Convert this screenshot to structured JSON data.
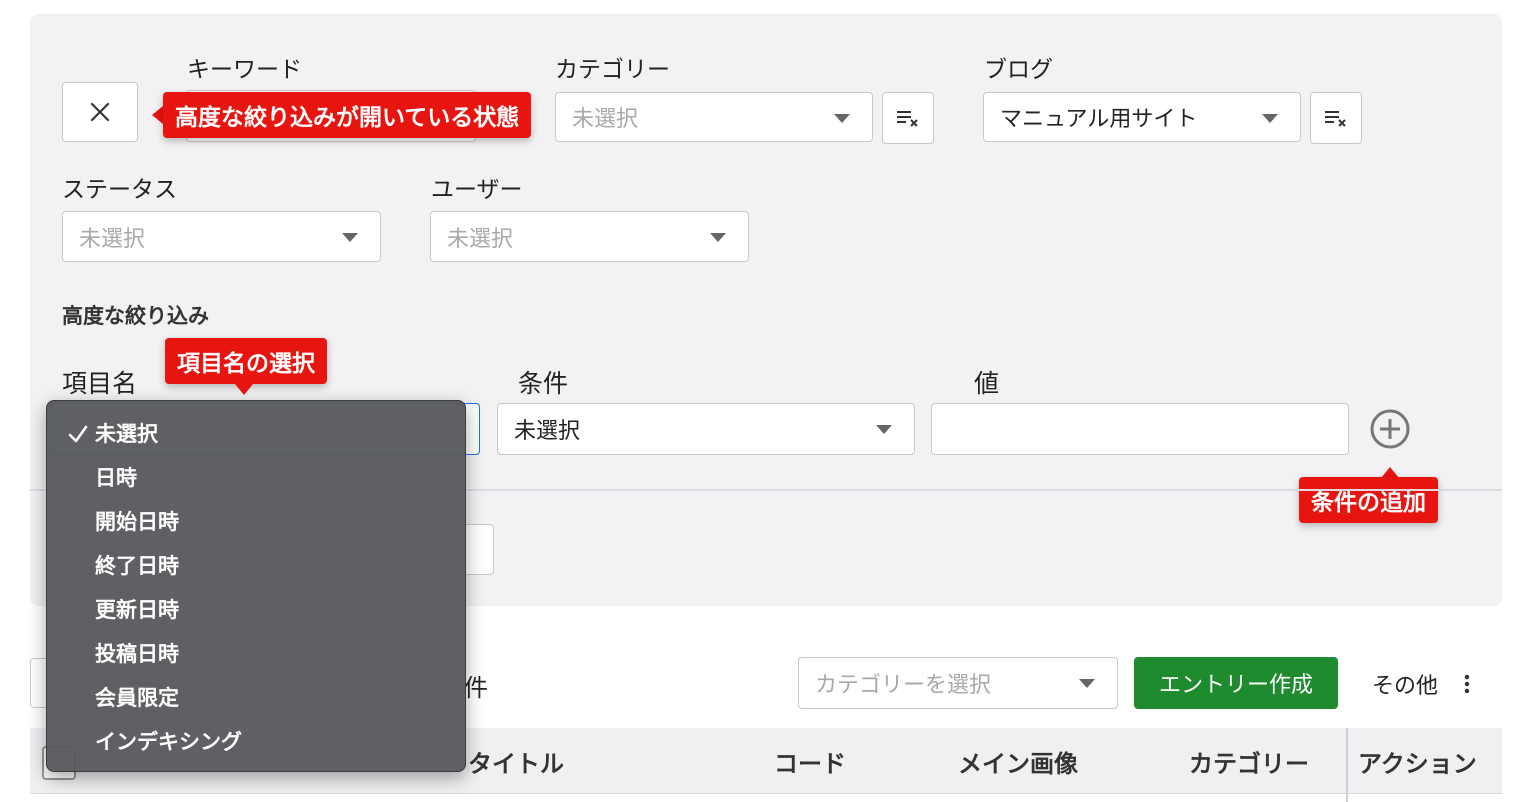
{
  "filter": {
    "keyword_label": "キーワード",
    "category_label": "カテゴリー",
    "category_value": "未選択",
    "blog_label": "ブログ",
    "blog_value": "マニュアル用サイト",
    "status_label": "ステータス",
    "status_value": "未選択",
    "user_label": "ユーザー",
    "user_value": "未選択"
  },
  "advanced": {
    "heading": "高度な絞り込み",
    "field_label": "項目名",
    "condition_label": "条件",
    "condition_value": "未選択",
    "value_label": "値",
    "value_input": ""
  },
  "dropdown": {
    "items": [
      {
        "label": "未選択",
        "checked": true
      },
      {
        "label": "日時"
      },
      {
        "label": "開始日時"
      },
      {
        "label": "終了日時"
      },
      {
        "label": "更新日時"
      },
      {
        "label": "投稿日時"
      },
      {
        "label": "会員限定"
      },
      {
        "label": "インデキシング"
      }
    ]
  },
  "callouts": {
    "advanced_open": "高度な絞り込みが開いている状態",
    "field_select": "項目名の選択",
    "add_condition": "条件の追加"
  },
  "list_toolbar": {
    "count_suffix": "件",
    "category_placeholder": "カテゴリーを選択",
    "create_button": "エントリー作成",
    "more_label": "その他"
  },
  "table": {
    "columns": [
      "タイトル",
      "コード",
      "メイン画像",
      "カテゴリー",
      "アクション"
    ]
  },
  "colors": {
    "accent_green": "#1e8c2e",
    "callout_red": "#e8140f",
    "focus_blue": "#1a73e8"
  },
  "icons": {
    "close": "close-icon",
    "clear_filter": "clear-filter-icon",
    "add_circle": "plus-circle-icon",
    "kebab": "kebab-icon",
    "check": "check-icon"
  }
}
